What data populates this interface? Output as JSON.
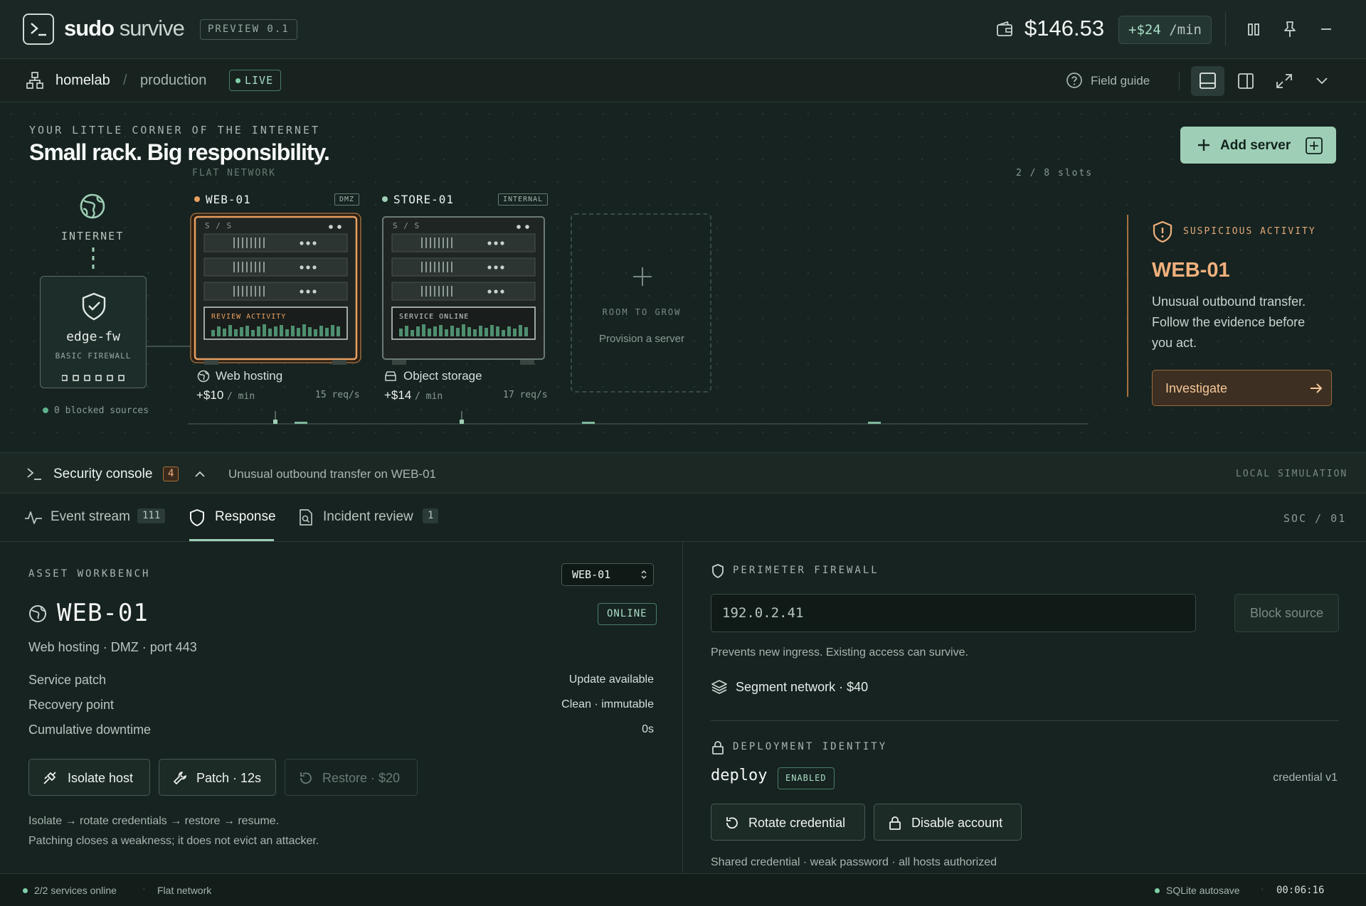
{
  "app": {
    "brand_primary": "sudo",
    "brand_secondary": "survive",
    "version_badge": "PREVIEW 0.1",
    "balance": "$146.53",
    "rate": "+$24",
    "rate_unit": "/min"
  },
  "breadcrumb": {
    "home": "homelab",
    "separator": "/",
    "env": "production",
    "status": "LIVE",
    "field_guide": "Field guide"
  },
  "rack": {
    "tagline": "YOUR LITTLE CORNER OF THE INTERNET",
    "headline": "Small rack. Big responsibility.",
    "network_label": "FLAT NETWORK",
    "slots": "2 / 8 slots",
    "add_server": "Add server",
    "internet_label": "INTERNET",
    "firewall": {
      "name": "edge-fw",
      "subtitle": "BASIC FIREWALL",
      "blocked": "0 blocked sources"
    },
    "servers": [
      {
        "name": "WEB-01",
        "zone": "DMZ",
        "plate": "S / S",
        "panel_status": "REVIEW ACTIVITY",
        "role": "Web hosting",
        "earn": "+$10",
        "earn_unit": "/ min",
        "load": "15 req/s",
        "status_color": "#e8a060"
      },
      {
        "name": "STORE-01",
        "zone": "INTERNAL",
        "plate": "S / S",
        "panel_status": "SERVICE ONLINE",
        "role": "Object storage",
        "earn": "+$14",
        "earn_unit": "/ min",
        "load": "17 req/s",
        "status_color": "#9ecfb6"
      }
    ],
    "empty_slot": {
      "title": "ROOM TO GROW",
      "subtitle": "Provision a server"
    }
  },
  "alert": {
    "kicker": "SUSPICIOUS ACTIVITY",
    "host": "WEB-01",
    "body": "Unusual outbound transfer. Follow the evidence before you act.",
    "action": "Investigate"
  },
  "console": {
    "title": "Security console",
    "count": "4",
    "message": "Unusual outbound transfer on WEB-01",
    "mode": "LOCAL SIMULATION"
  },
  "tabs": {
    "event_stream": {
      "label": "Event stream",
      "count": "111"
    },
    "response": {
      "label": "Response"
    },
    "incident_review": {
      "label": "Incident review",
      "count": "1"
    },
    "context": "SOC / 01"
  },
  "workbench": {
    "kicker": "ASSET WORKBENCH",
    "selected_host": "WEB-01",
    "host_name": "WEB-01",
    "status": "ONLINE",
    "meta": "Web hosting · DMZ · port 443",
    "rows": [
      {
        "key": "Service patch",
        "value": "Update available"
      },
      {
        "key": "Recovery point",
        "value": "Clean · immutable"
      },
      {
        "key": "Cumulative downtime",
        "value": "0s"
      }
    ],
    "actions": {
      "isolate": "Isolate host",
      "patch": "Patch · 12s",
      "restore": "Restore · $20"
    },
    "hint_1": "Isolate → rotate credentials → restore → resume.",
    "hint_2": "Patching closes a weakness; it does not evict an attacker."
  },
  "firewall_panel": {
    "kicker": "PERIMETER FIREWALL",
    "ip_value": "192.0.2.41",
    "block_button": "Block source",
    "note": "Prevents new ingress. Existing access can survive.",
    "segment": "Segment network · $40"
  },
  "identity": {
    "kicker": "DEPLOYMENT IDENTITY",
    "account": "deploy",
    "state": "ENABLED",
    "credential": "credential v1",
    "rotate": "Rotate credential",
    "disable": "Disable account",
    "note": "Shared credential · weak password · all hosts authorized"
  },
  "statusbar": {
    "services": "2/2 services online",
    "network": "Flat network",
    "autosave": "SQLite autosave",
    "clock": "00:06:16"
  },
  "colors": {
    "accent": "#9ecfb6",
    "warning": "#f0b07c",
    "background": "#172320"
  }
}
